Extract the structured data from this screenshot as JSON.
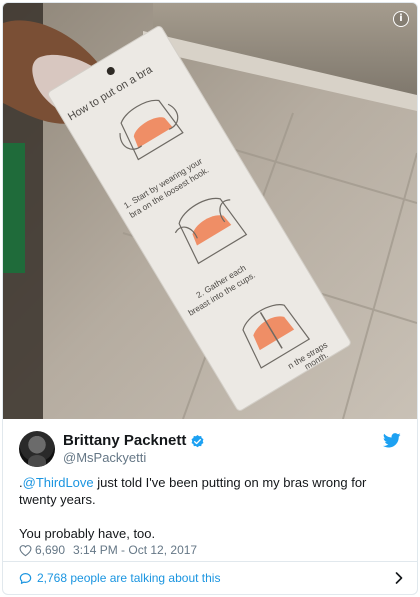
{
  "media": {
    "card_title": "How to put on a bra",
    "step1": "1. Start by wearing your",
    "step1b": "bra on the loosest hook.",
    "step2": "2. Gather each",
    "step2b": "breast into the cups.",
    "step3": "n the straps",
    "step3b": "month.",
    "info_icon": "info-icon",
    "info_symbol": "i"
  },
  "tweet": {
    "display_name": "Brittany Packnett",
    "handle": "@MsPackyetti",
    "verified_icon": "verified-badge-icon",
    "logo_icon": "twitter-bird-icon",
    "text_prefix": ".",
    "mention": "@ThirdLove",
    "text_line1_rest": " just told I've been putting on my bras wrong for twenty years.",
    "text_line2": "You probably have, too.",
    "likes": "6,690",
    "timestamp": "3:14 PM - Oct 12, 2017"
  },
  "footer": {
    "talking": "2,768 people are talking about this",
    "icon": "comment-bubble-icon",
    "chevron": "chevron-right-icon"
  },
  "colors": {
    "accent": "#1b95e0",
    "muted": "#657786",
    "border": "#e1e8ed"
  }
}
